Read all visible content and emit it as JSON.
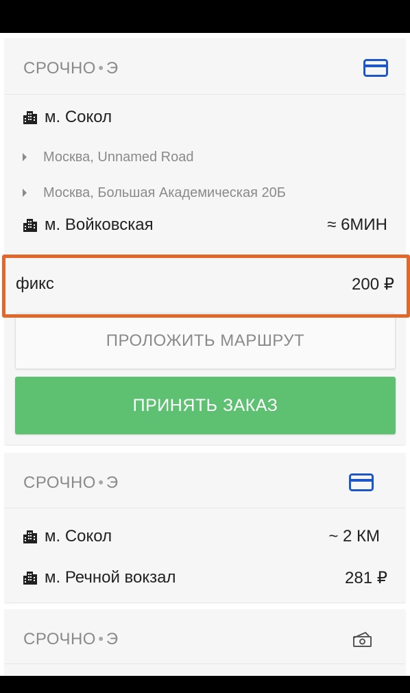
{
  "orders": [
    {
      "title": "СРОЧНО",
      "title_suffix": "Э",
      "payment_icon": "credit-card-icon",
      "from": "м. Сокол",
      "via": [
        "Москва, Unnamed Road",
        "Москва,  Большая Академическая 20Б"
      ],
      "to": "м. Войковская",
      "eta": "≈ 6МИН",
      "tariff_label": "фикс",
      "price": "200 ₽",
      "route_button": "ПРОЛОЖИТЬ МАРШРУТ",
      "accept_button": "ПРИНЯТЬ ЗАКАЗ"
    },
    {
      "title": "СРОЧНО",
      "title_suffix": "Э",
      "payment_icon": "credit-card-icon",
      "from": "м. Сокол",
      "distance": "~ 2 КМ",
      "to": "м. Речной вокзал",
      "price": "281 ₽"
    },
    {
      "title": "СРОЧНО",
      "title_suffix": "Э",
      "payment_icon": "cash-icon"
    }
  ],
  "colors": {
    "accent_blue": "#1e56c8",
    "accept_green": "#5ec172",
    "highlight": "#e2672b"
  }
}
